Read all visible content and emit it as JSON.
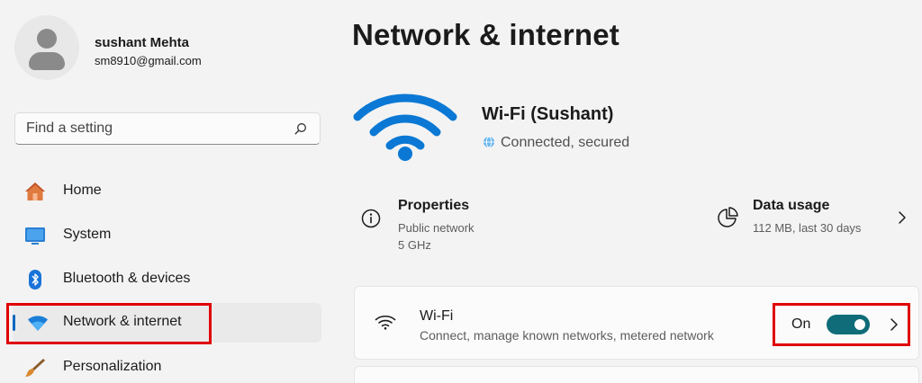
{
  "user": {
    "name": "sushant Mehta",
    "email": "sm8910@gmail.com"
  },
  "search": {
    "placeholder": "Find a setting"
  },
  "sidebar": {
    "items": [
      {
        "label": "Home",
        "icon": "home-icon"
      },
      {
        "label": "System",
        "icon": "system-icon"
      },
      {
        "label": "Bluetooth & devices",
        "icon": "bluetooth-icon"
      },
      {
        "label": "Network & internet",
        "icon": "wifi-icon",
        "active": true
      },
      {
        "label": "Personalization",
        "icon": "brush-icon"
      }
    ]
  },
  "main": {
    "title": "Network & internet",
    "connection": {
      "name": "Wi-Fi (Sushant)",
      "status": "Connected, secured"
    },
    "properties": {
      "title": "Properties",
      "line1": "Public network",
      "line2": "5 GHz"
    },
    "data_usage": {
      "title": "Data usage",
      "line1": "112 MB, last 30 days"
    },
    "wifi_card": {
      "title": "Wi-Fi",
      "subtitle": "Connect, manage known networks, metered network",
      "toggle_label": "On",
      "toggle_on": true
    }
  },
  "colors": {
    "accent": "#0067c0",
    "toggle": "#0f6c78",
    "highlight": "#e00000",
    "wifi_blue": "#0a78d4"
  }
}
